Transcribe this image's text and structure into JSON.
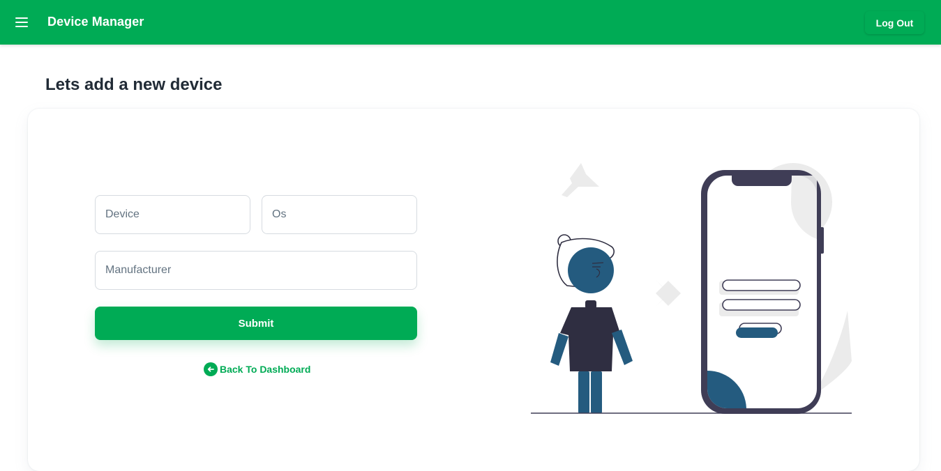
{
  "header": {
    "app_title": "Device Manager",
    "logout_label": "Log Out",
    "menu_icon": "hamburger-menu-icon"
  },
  "page": {
    "heading": "Lets add a new device"
  },
  "form": {
    "device_placeholder": "Device",
    "os_placeholder": "Os",
    "manufacturer_placeholder": "Manufacturer",
    "submit_label": "Submit",
    "back_label": "Back To Dashboard",
    "back_icon": "arrow-left-circle-icon"
  },
  "colors": {
    "brand": "#00ab55",
    "heading_text": "#212b36",
    "illustration_dark": "#3f3d56",
    "illustration_accent": "#245b7f"
  }
}
